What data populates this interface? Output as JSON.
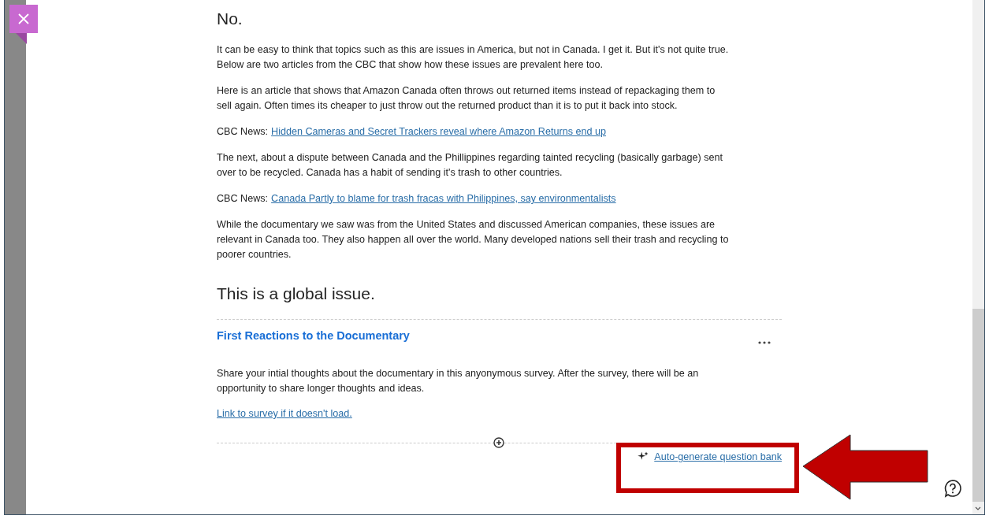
{
  "blocks": [
    {
      "kind": "heading",
      "text": "No."
    },
    {
      "kind": "paragraph",
      "text": "It can be easy to think that topics such as this are issues in America, but not in Canada. I get it. But it's not quite true. Below are two articles from the CBC that show how these issues are prevalent here too."
    },
    {
      "kind": "paragraph",
      "text": "Here is an article that shows that Amazon Canada often throws out returned items instead of repackaging them to sell again. Often times its cheaper to just throw out the returned product than it is to put it back into stock."
    },
    {
      "kind": "link",
      "prefix": "CBC News:",
      "text": "Hidden Cameras and Secret Trackers reveal where Amazon Returns end up"
    },
    {
      "kind": "paragraph",
      "text": "The next, about a dispute between Canada and the Phillippines regarding tainted recycling (basically garbage) sent over to be recycled. Canada has a habit of sending it's trash to other countries."
    },
    {
      "kind": "link",
      "prefix": "CBC News:",
      "text": "Canada Partly to blame for trash fracas with Philippines, say environmentalists"
    },
    {
      "kind": "paragraph",
      "text": "While the documentary we saw was from the United States and discussed American companies, these issues are relevant in Canada too. They also happen all over the world. Many developed nations sell their trash and recycling to poorer countries."
    },
    {
      "kind": "heading",
      "text": "This is a global issue."
    }
  ],
  "item": {
    "title": "First Reactions to the Documentary",
    "description": "Share your intial thoughts about the documentary in this anyonymous survey. After the survey, there will be an opportunity to share longer thoughts and ideas.",
    "link": "Link to survey if it doesn't load."
  },
  "auto_generate_link": "Auto-generate question bank"
}
